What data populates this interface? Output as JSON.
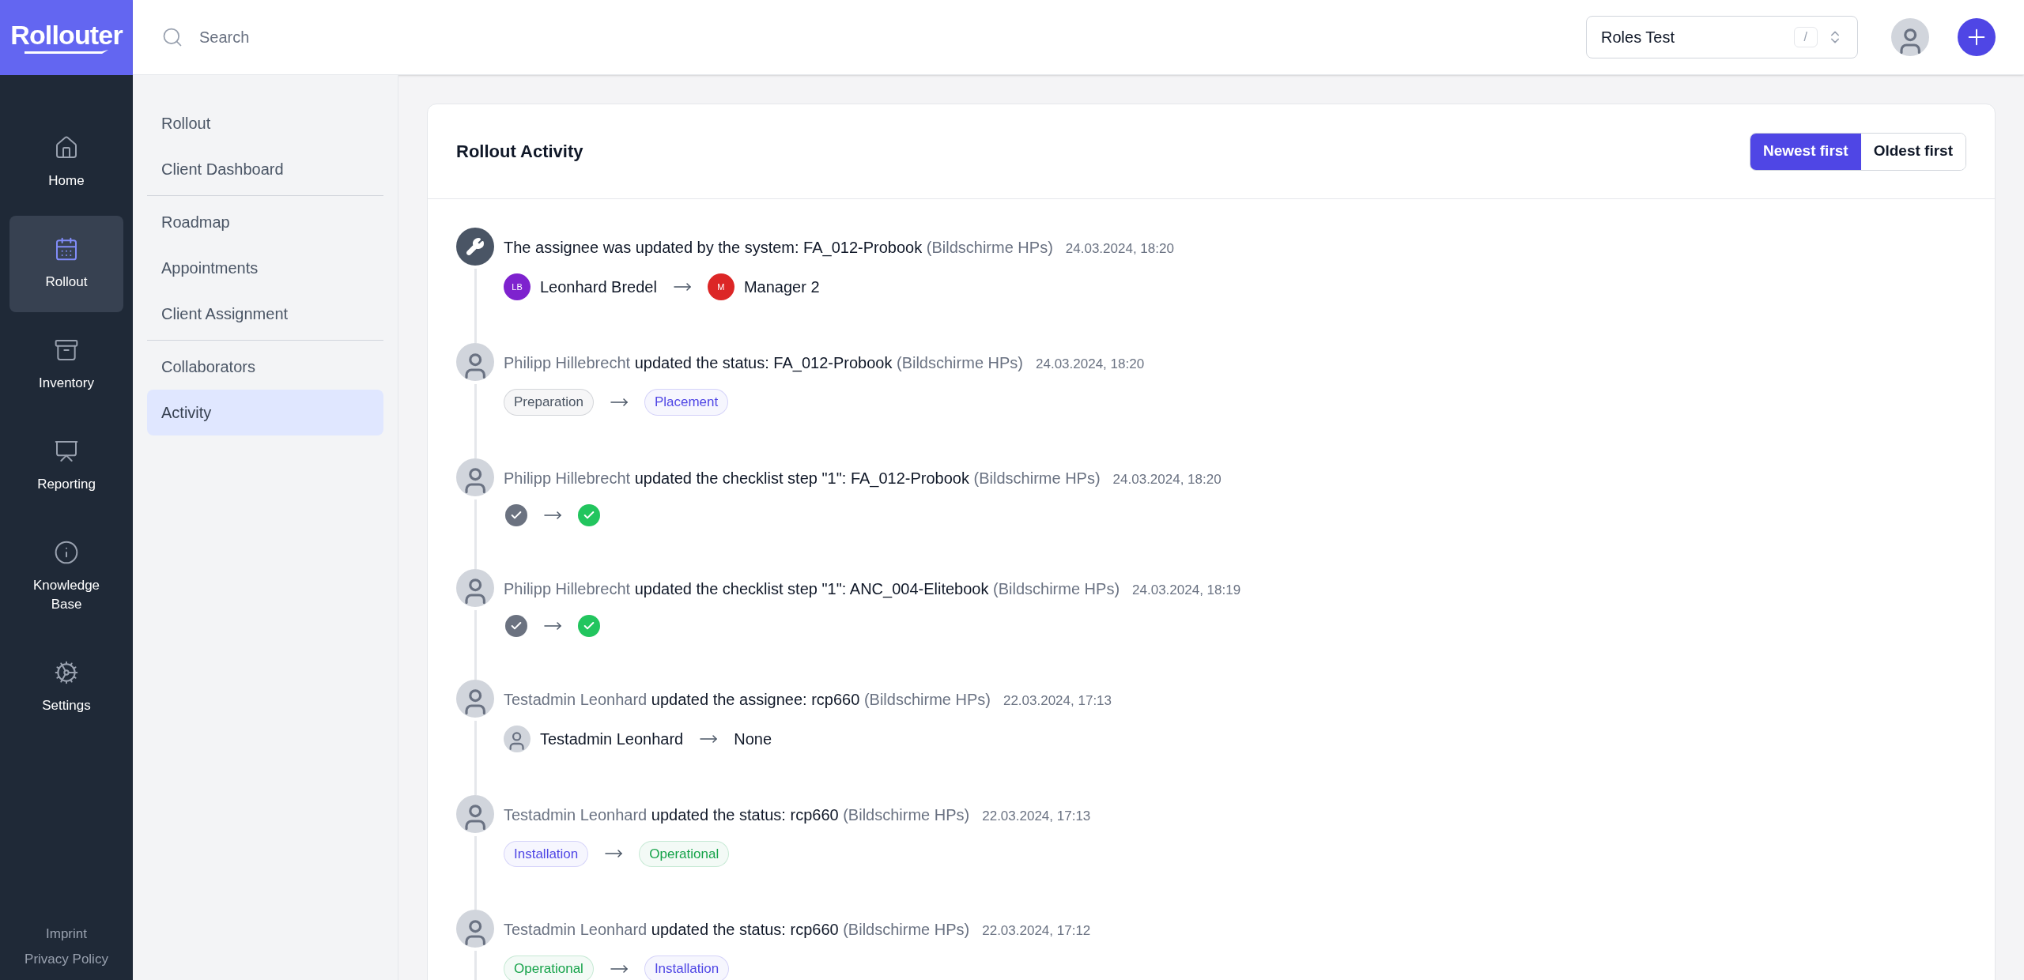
{
  "logo": "Rollouter",
  "search": {
    "placeholder": "Search"
  },
  "project_select": {
    "value": "Roles Test",
    "shortcut": "/"
  },
  "rail": {
    "items": [
      {
        "label": "Home",
        "selected": false
      },
      {
        "label": "Rollout",
        "selected": true
      },
      {
        "label": "Inventory",
        "selected": false
      },
      {
        "label": "Reporting",
        "selected": false
      },
      {
        "label": "Knowledge Base",
        "selected": false
      },
      {
        "label": "Settings",
        "selected": false
      }
    ],
    "footer_links": [
      "Imprint",
      "Privacy Policy"
    ]
  },
  "subnav": [
    [
      {
        "label": "Rollout",
        "selected": false
      },
      {
        "label": "Client Dashboard",
        "selected": false
      }
    ],
    [
      {
        "label": "Roadmap",
        "selected": false
      },
      {
        "label": "Appointments",
        "selected": false
      },
      {
        "label": "Client Assignment",
        "selected": false
      }
    ],
    [
      {
        "label": "Collaborators",
        "selected": false
      },
      {
        "label": "Activity",
        "selected": true
      }
    ]
  ],
  "card": {
    "title": "Rollout Activity",
    "sort": [
      {
        "label": "Newest first",
        "selected": true
      },
      {
        "label": "Oldest first",
        "selected": false
      }
    ],
    "activities": [
      {
        "actor": {
          "kind": "system"
        },
        "action": "The assignee was updated by the system: FA_012-Probook",
        "group": "(Bildschirme HPs)",
        "time": "24.03.2024, 18:20",
        "change": {
          "kind": "assignee",
          "from": {
            "kind": "initials",
            "initials": "LB",
            "name": "Leonhard Bredel",
            "color": "#7e22ce"
          },
          "to": {
            "kind": "initials",
            "initials": "M",
            "name": "Manager 2",
            "color": "#dc2626"
          }
        }
      },
      {
        "actor": {
          "kind": "person",
          "name": "Philipp Hillebrecht"
        },
        "action": "updated the status: FA_012-Probook",
        "group": "(Bildschirme HPs)",
        "time": "24.03.2024, 18:20",
        "change": {
          "kind": "status",
          "from": {
            "label": "Preparation",
            "color": "#4b5563"
          },
          "to": {
            "label": "Placement",
            "color": "#4f46e5"
          }
        }
      },
      {
        "actor": {
          "kind": "person",
          "name": "Philipp Hillebrecht"
        },
        "action": "updated the checklist step \"1\": FA_012-Probook",
        "group": "(Bildschirme HPs)",
        "time": "24.03.2024, 18:20",
        "change": {
          "kind": "checklist",
          "from": {
            "color": "#6b7280"
          },
          "to": {
            "color": "#22c55e"
          }
        }
      },
      {
        "actor": {
          "kind": "person",
          "name": "Philipp Hillebrecht"
        },
        "action": "updated the checklist step \"1\": ANC_004-Elitebook",
        "group": "(Bildschirme HPs)",
        "time": "24.03.2024, 18:19",
        "change": {
          "kind": "checklist",
          "from": {
            "color": "#6b7280"
          },
          "to": {
            "color": "#22c55e"
          }
        }
      },
      {
        "actor": {
          "kind": "person",
          "name": "Testadmin Leonhard"
        },
        "action": "updated the assignee: rcp660",
        "group": "(Bildschirme HPs)",
        "time": "22.03.2024, 17:13",
        "change": {
          "kind": "assignee",
          "from": {
            "kind": "photo",
            "name": "Testadmin Leonhard"
          },
          "to": {
            "kind": "none",
            "name": "None"
          }
        }
      },
      {
        "actor": {
          "kind": "person",
          "name": "Testadmin Leonhard"
        },
        "action": "updated the status: rcp660",
        "group": "(Bildschirme HPs)",
        "time": "22.03.2024, 17:13",
        "change": {
          "kind": "status",
          "from": {
            "label": "Installation",
            "color": "#4f46e5"
          },
          "to": {
            "label": "Operational",
            "color": "#16a34a"
          }
        }
      },
      {
        "actor": {
          "kind": "person",
          "name": "Testadmin Leonhard"
        },
        "action": "updated the status: rcp660",
        "group": "(Bildschirme HPs)",
        "time": "22.03.2024, 17:12",
        "change": {
          "kind": "status",
          "from": {
            "label": "Operational",
            "color": "#16a34a"
          },
          "to": {
            "label": "Installation",
            "color": "#4f46e5"
          }
        }
      }
    ]
  }
}
